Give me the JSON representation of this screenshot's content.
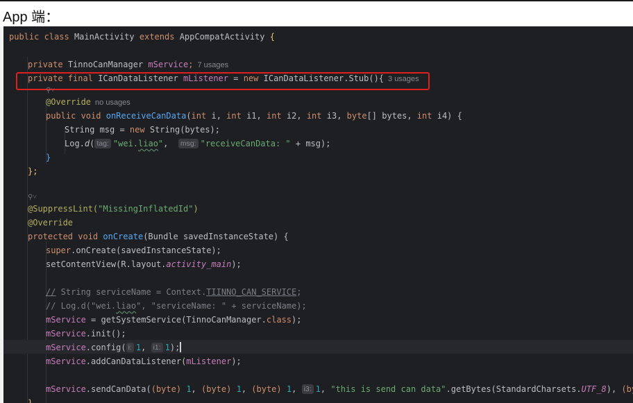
{
  "document": {
    "title": "App 端："
  },
  "code": {
    "class_kw": "public class",
    "class_name": "MainActivity",
    "extends_kw": "extends",
    "super_class": "AppCompatActivity",
    "open_brace": "{",
    "field1": {
      "modifier": "private",
      "type": "TinnoCanManager",
      "name": "mService",
      "semicolon": ";",
      "usages": "7 usages"
    },
    "field2": {
      "modifier": "private final",
      "type": "ICanDataListener",
      "name": "mListener",
      "assign": " = ",
      "new_kw": "new",
      "ctor": "ICanDataListener.Stub(){",
      "usages": "3 usages"
    },
    "override1": "@Override",
    "override1_usages": "no usages",
    "on_receive": {
      "modifier": "public void",
      "name": "onReceiveCanData",
      "params_a": "(",
      "int_kw": "int",
      "p1": "i",
      "p2": "i1",
      "p3": "i2",
      "p4": "i3",
      "byte_kw": "byte",
      "p5": "[] bytes",
      "p6": "i4",
      "params_b": ") {"
    },
    "msg_line": {
      "type": "String msg = ",
      "new_kw": "new",
      "rest": "String(bytes);"
    },
    "log_line": {
      "prefix": "Log.",
      "method": "d",
      "open": "(",
      "tag_hint": "tag:",
      "tag_value_a": "\"wei.",
      "tag_value_b": "liao",
      "tag_value_c": "\"",
      "msg_hint": "msg:",
      "msg_value": "\"receiveCanData: \"",
      "rest": " + msg);"
    },
    "close_inner": "}",
    "close_anon": "};",
    "suppress": "@SuppressLint(",
    "suppress_arg": "\"MissingInflatedId\"",
    "suppress_close": ")",
    "override2": "@Override",
    "on_create": {
      "modifier": "protected void",
      "name": "onCreate",
      "params": "(Bundle savedInstanceState) {"
    },
    "super_line": {
      "kw": "super",
      "rest": ".onCreate(savedInstanceState);"
    },
    "content_line": {
      "prefix": "setContentView(R.layout.",
      "field": "activity_main",
      "suffix": ");"
    },
    "comment1": {
      "slashes": "//",
      "text_a": " String serviceName = Context.",
      "text_b": "TIINNO_CAN_SERVICE",
      "text_c": ";"
    },
    "comment2": {
      "text_a": "// Log.d(\"wei.",
      "text_b": "liao",
      "text_c": "\", \"serviceName: \" + serviceName);"
    },
    "assign_line": {
      "field": "mService",
      "rest_a": " = getSystemService(TinnoCanManager.",
      "class_kw": "class",
      "rest_b": ");"
    },
    "init_line": {
      "field": "mService",
      "rest": ".init();"
    },
    "config_line": {
      "field": "mService",
      "rest_a": ".config(",
      "hint1": "i:",
      "val1": "1",
      "sep": ", ",
      "hint2": "i1:",
      "val2": "1",
      "rest_b": ");"
    },
    "listener_line": {
      "field": "mService",
      "rest_a": ".addCanDataListener(",
      "arg": "mListener",
      "rest_b": ");"
    },
    "send_line": {
      "field": "mService",
      "rest_a": ".sendCanData(",
      "cast": "(byte)",
      "one": "1",
      "comma": ", ",
      "hint": "i3:",
      "str": "\"this is send can data\"",
      "get_bytes": ".getBytes(StandardCharsets.",
      "charset": "UTF_8",
      "close": "), ",
      "end": ");"
    },
    "last_brace": "}"
  },
  "colors": {
    "editor_bg": "#1e1f22",
    "keyword": "#cf8e6d",
    "field": "#c77dbb",
    "method": "#56a8f5",
    "string": "#6aab73",
    "number": "#2aacb8",
    "annotation": "#b3ae60",
    "comment": "#7a7e85",
    "highlight_box": "#e0201f"
  },
  "icons": {
    "gutter": "override-marker-icon"
  }
}
